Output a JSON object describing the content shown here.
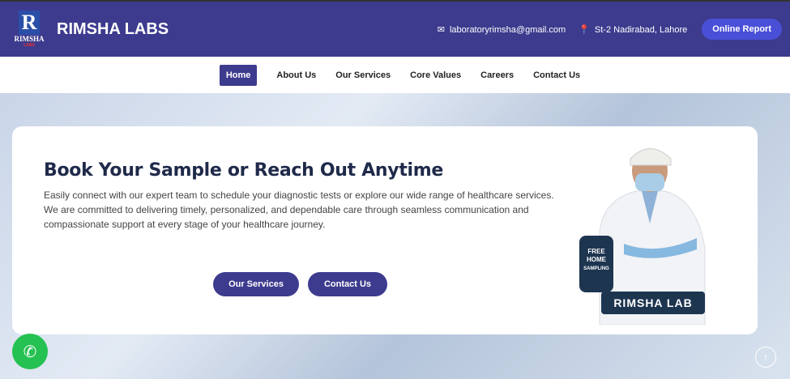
{
  "header": {
    "logo_text": "RIMSHA",
    "logo_sub": "LABS",
    "brand": "RIMSHA LABS",
    "email": "laboratoryrimsha@gmail.com",
    "address": "St-2 Nadirabad, Lahore",
    "report_button": "Online Report"
  },
  "nav": {
    "items": [
      {
        "label": "Home",
        "active": true
      },
      {
        "label": "About Us"
      },
      {
        "label": "Our Services"
      },
      {
        "label": "Core Values"
      },
      {
        "label": "Careers"
      },
      {
        "label": "Contact Us"
      }
    ]
  },
  "hero": {
    "title": "Book Your Sample or Reach Out Anytime",
    "description": "Easily connect with our expert team to schedule your diagnostic tests or explore our wide range of healthcare services. We are committed to delivering timely, personalized, and dependable care through seamless communication and compassionate support at every stage of your healthcare journey.",
    "buttons": [
      "Our Services",
      "Contact Us"
    ],
    "image_bag_text": "FREE HOME SAMPLING",
    "image_banner": "RIMSHA LAB"
  },
  "colors": {
    "primary": "#3d3b8e",
    "accent": "#4a4fd8",
    "whatsapp": "#25c152"
  }
}
